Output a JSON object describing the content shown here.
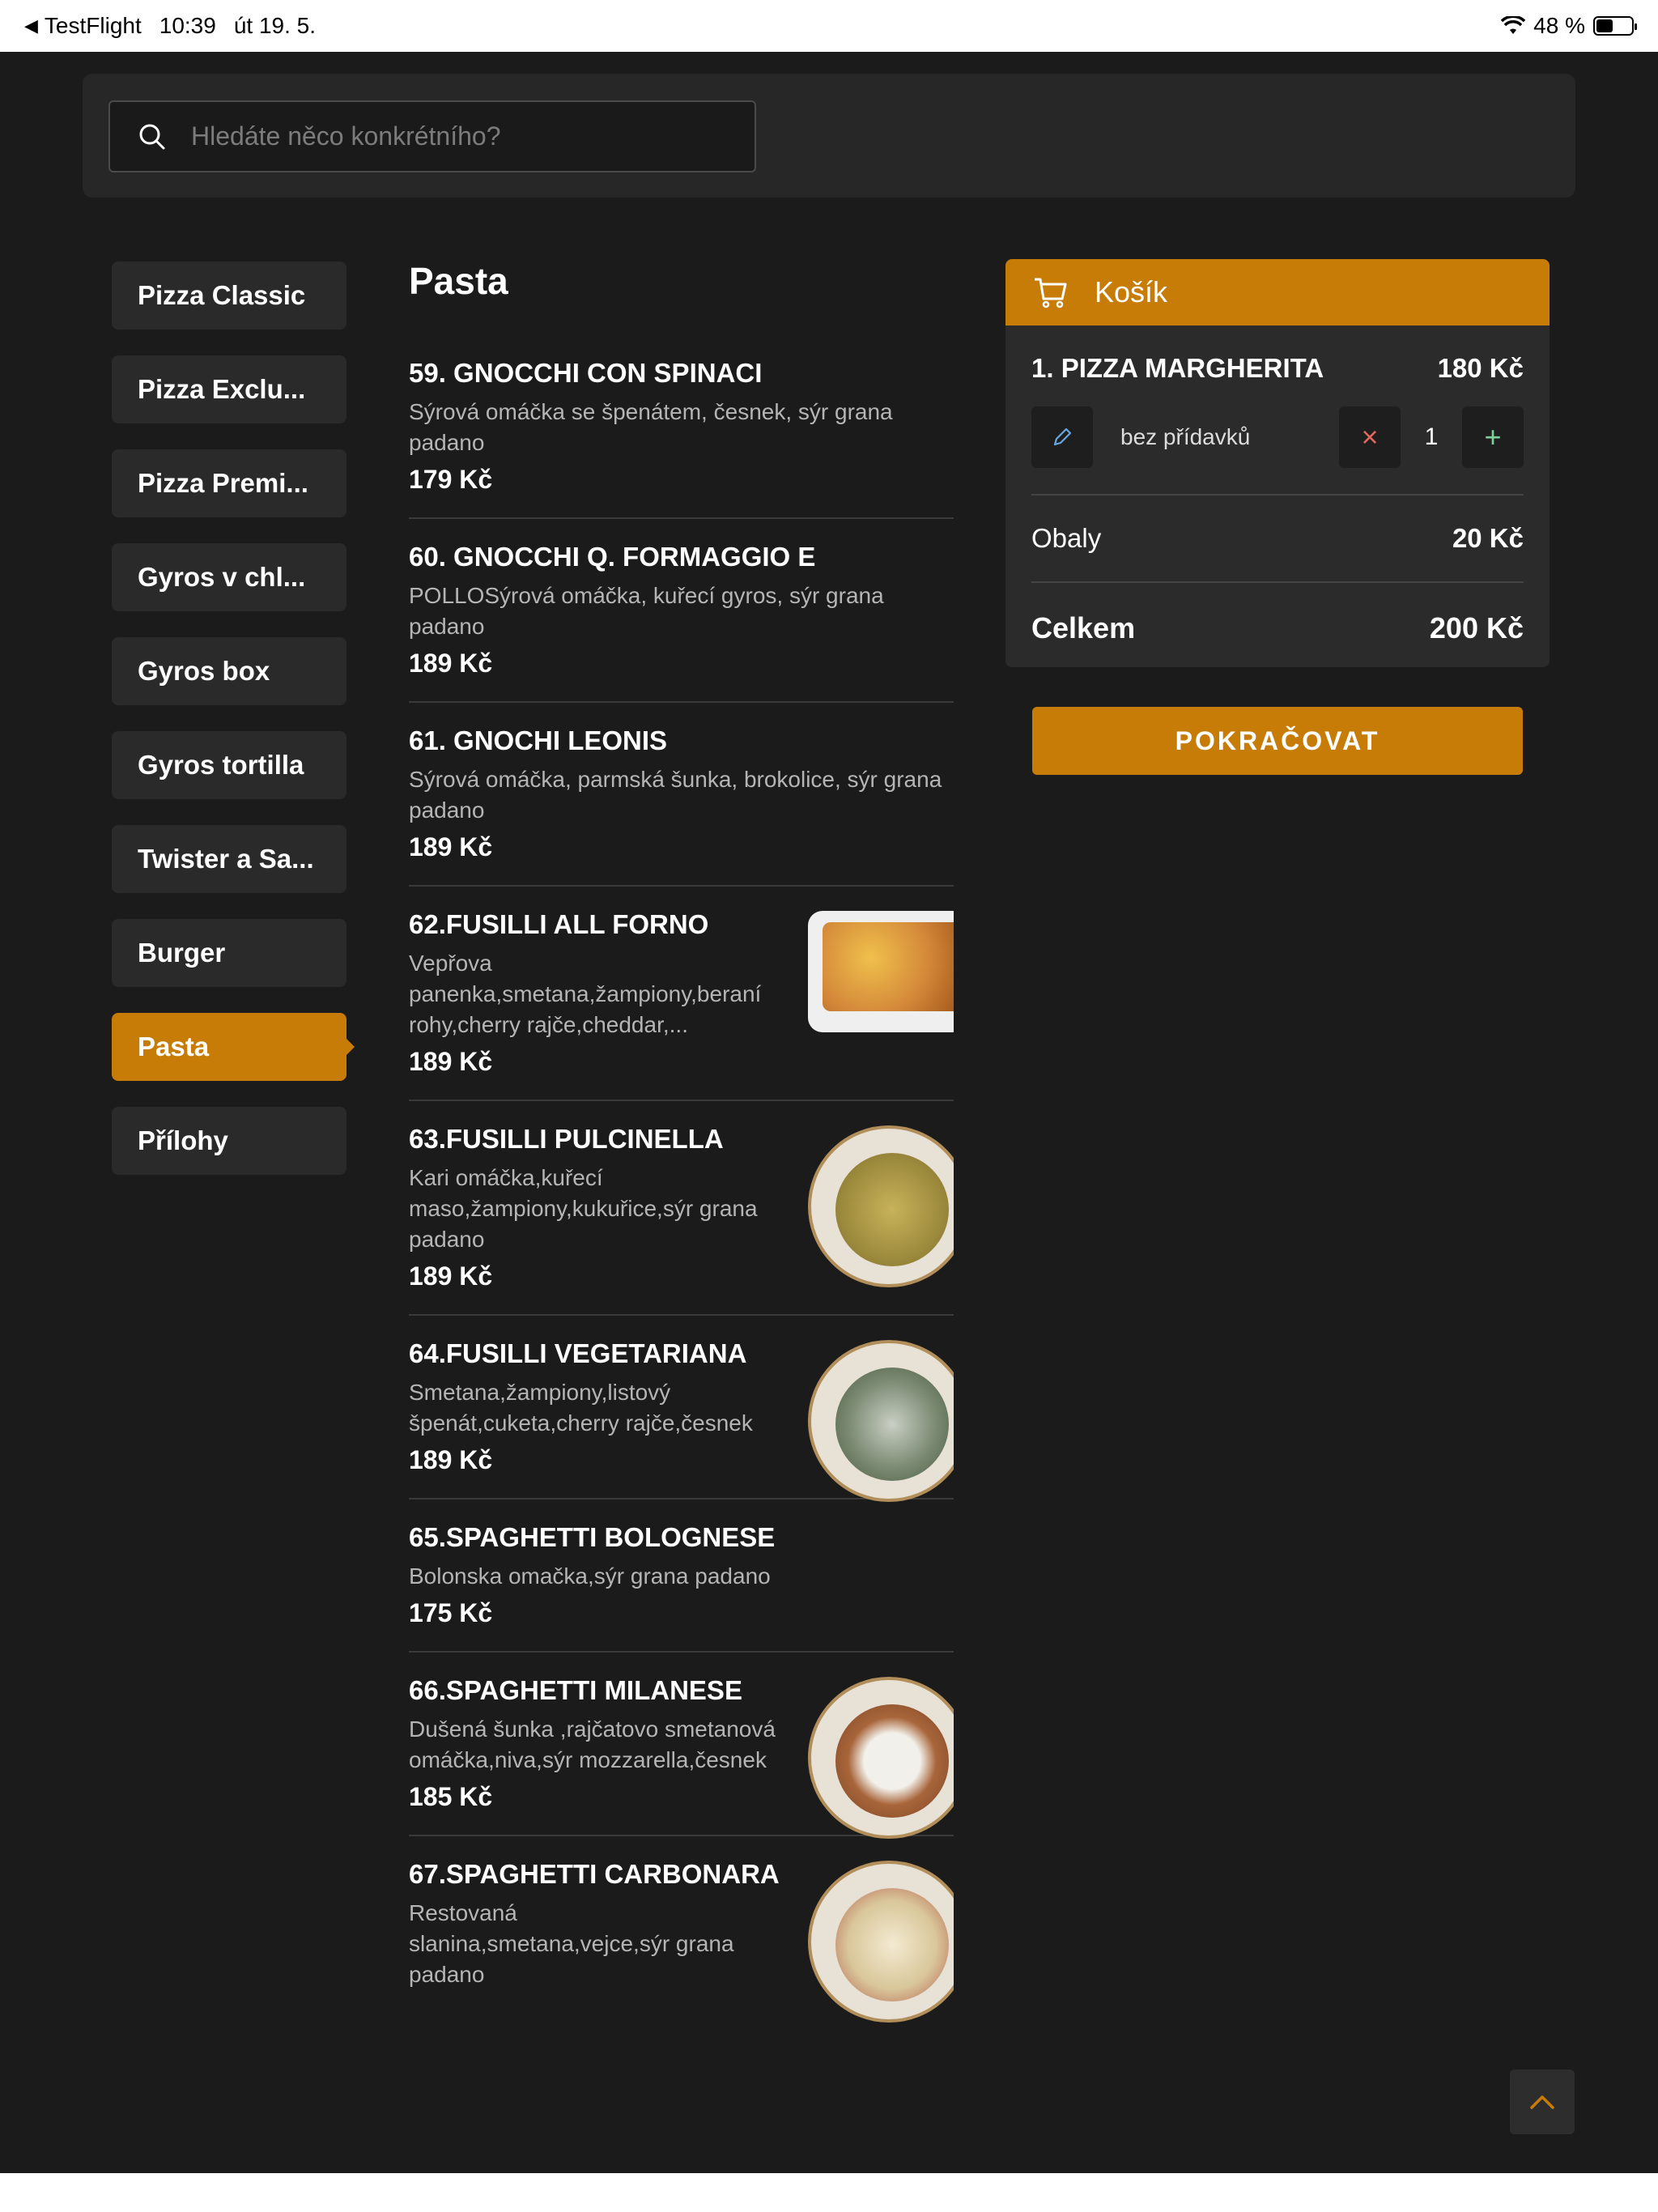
{
  "status": {
    "app": "TestFlight",
    "time": "10:39",
    "date": "út 19. 5.",
    "battery": "48 %",
    "battery_level": 0.48
  },
  "search": {
    "placeholder": "Hledáte něco konkrétního?"
  },
  "categories": [
    "Pizza Classic",
    "Pizza Exclu...",
    "Pizza Premi...",
    "Gyros v chl...",
    "Gyros box",
    "Gyros tortilla",
    "Twister a Sa...",
    "Burger",
    "Pasta",
    "Přílohy"
  ],
  "menu": {
    "title": "Pasta",
    "items": [
      {
        "name": "59. GNOCCHI CON SPINACI",
        "desc": "Sýrová omáčka se špenátem, česnek, sýr grana padano",
        "price": "179 Kč"
      },
      {
        "name": "60. GNOCCHI Q. FORMAGGIO E",
        "desc": "POLLOSýrová omáčka, kuřecí gyros, sýr grana padano",
        "price": "189 Kč"
      },
      {
        "name": "61. GNOCHI LEONIS",
        "desc": "Sýrová omáčka, parmská šunka, brokolice, sýr grana padano",
        "price": "189 Kč"
      },
      {
        "name": "62.FUSILLI ALL FORNO",
        "desc": "Vepřova panenka,smetana,žampiony,beraní rohy,cherry rajče,cheddar,...",
        "price": "189 Kč"
      },
      {
        "name": "63.FUSILLI PULCINELLA",
        "desc": "Kari omáčka,kuřecí maso,žampiony,kukuřice,sýr grana padano",
        "price": "189 Kč"
      },
      {
        "name": "64.FUSILLI VEGETARIANA",
        "desc": "Smetana,žampiony,listový špenát,cuketa,cherry rajče,česnek",
        "price": "189 Kč"
      },
      {
        "name": "65.SPAGHETTI BOLOGNESE",
        "desc": "Bolonska omačka,sýr grana padano",
        "price": "175 Kč"
      },
      {
        "name": "66.SPAGHETTI MILANESE",
        "desc": "Dušená šunka ,rajčatovo smetanová omáčka,niva,sýr mozzarella,česnek",
        "price": "185 Kč"
      },
      {
        "name": "67.SPAGHETTI CARBONARA",
        "desc": "Restovaná slanina,smetana,vejce,sýr grana padano",
        "price": ""
      }
    ]
  },
  "cart": {
    "title": "Košík",
    "item_name": "1. PIZZA MARGHERITA",
    "item_price": "180 Kč",
    "item_note": "bez přídavků",
    "qty": "1",
    "packaging_label": "Obaly",
    "packaging_value": "20 Kč",
    "total_label": "Celkem",
    "total_value": "200 Kč",
    "continue": "POKRAČOVAT"
  },
  "colors": {
    "accent": "#c77c07",
    "bg": "#1b1b1b",
    "panel": "#2b2b2b",
    "remove": "#e0685c",
    "add": "#7fd19a",
    "edit": "#6aa7e0"
  }
}
